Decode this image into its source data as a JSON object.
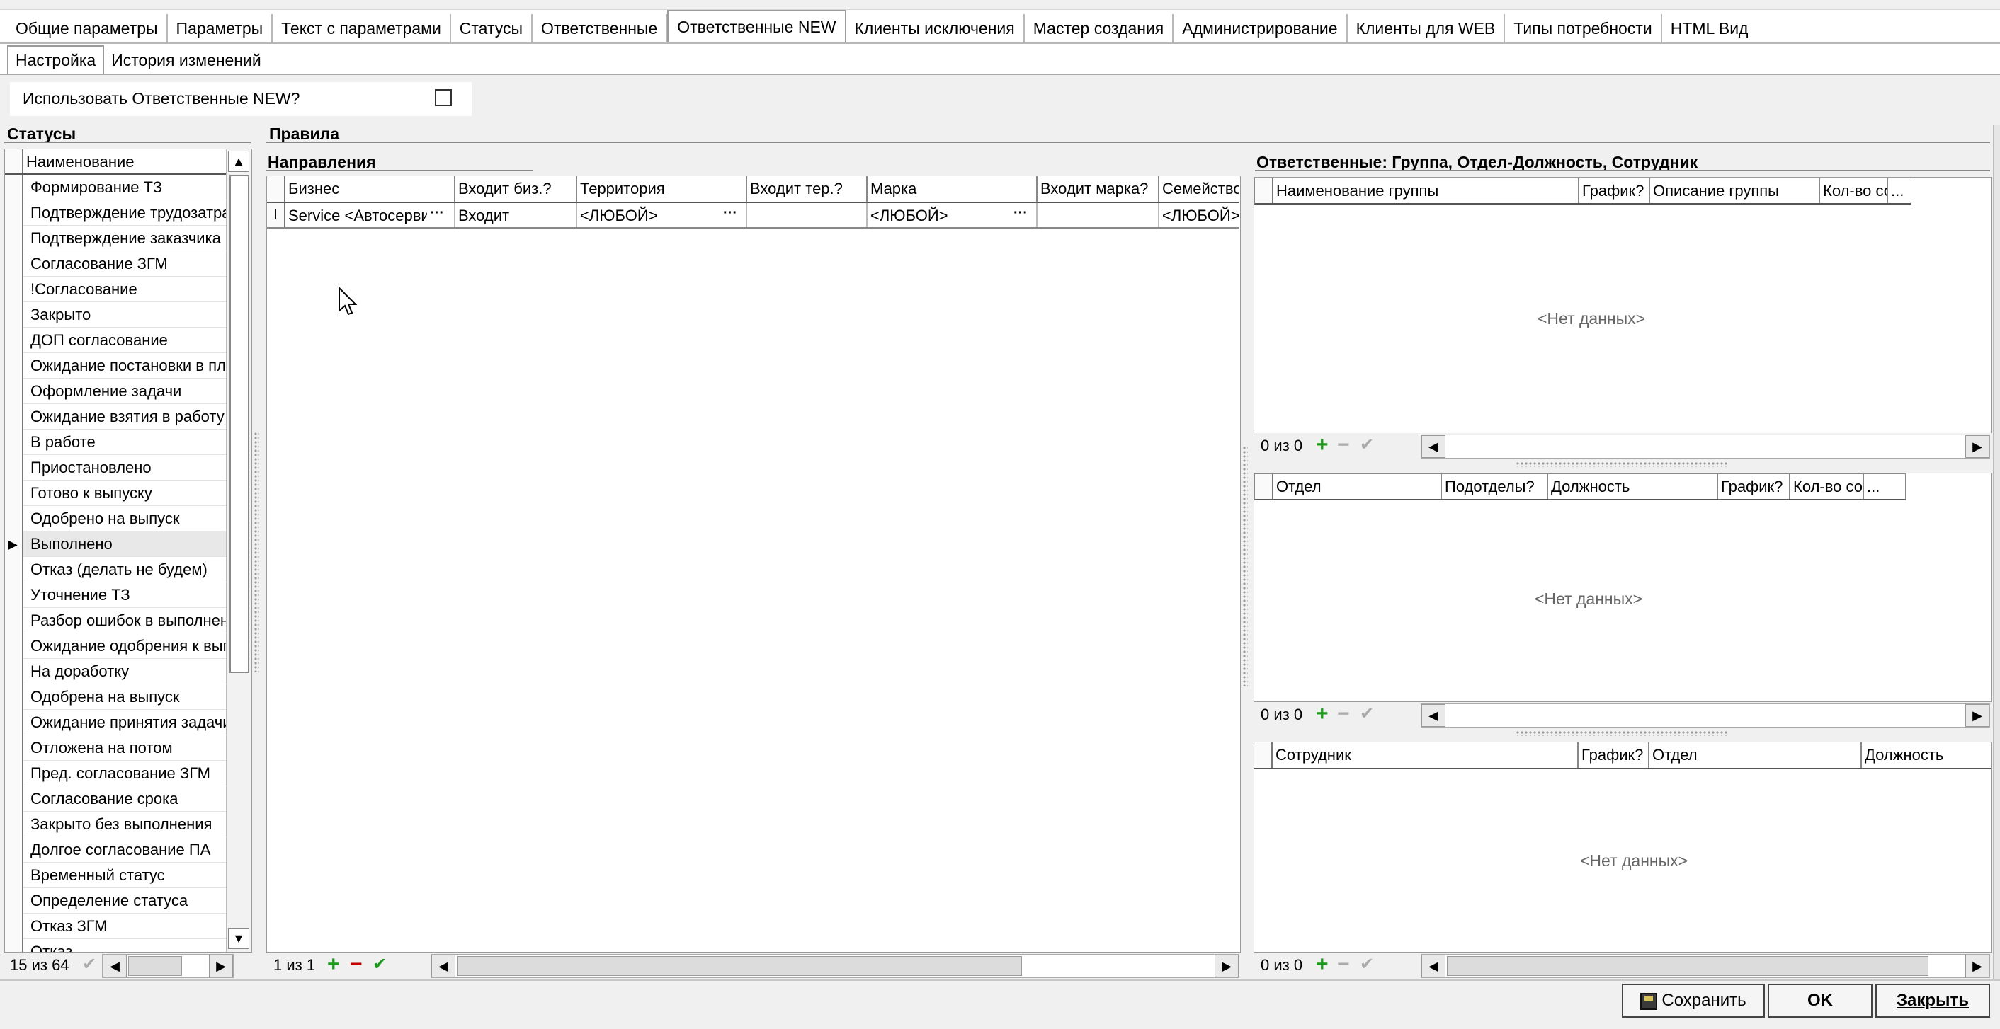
{
  "main_tabs": [
    "Общие параметры",
    "Параметры",
    "Текст с параметрами",
    "Статусы",
    "Ответственные",
    "Ответственные NEW",
    "Клиенты исключения",
    "Мастер создания",
    "Администрирование",
    "Клиенты для WEB",
    "Типы потребности",
    "HTML Вид"
  ],
  "active_main_tab": "Ответственные NEW",
  "sub_tabs": [
    "Настройка",
    "История изменений"
  ],
  "use_new": {
    "label": "Использовать Ответственные NEW?"
  },
  "statuses": {
    "title": "Статусы",
    "header": "Наименование",
    "items": [
      "Формирование ТЗ",
      "Подтверждение трудозатрат",
      "Подтверждение заказчика",
      "Согласование ЗГМ",
      "!Согласование",
      "Закрыто",
      "ДОП согласование",
      "Ожидание постановки в план",
      "Оформление задачи",
      "Ожидание взятия в работу",
      "В работе",
      "Приостановлено",
      "Готово к выпуску",
      "Одобрено на выпуск",
      "Выполнено",
      "Отказ (делать не будем)",
      "Уточнение ТЗ",
      "Разбор ошибок в выполнении",
      "Ожидание одобрения к выпуску",
      "На доработку",
      "Одобрена на выпуск",
      "Ожидание принятия задачи",
      "Отложена на потом",
      "Пред. согласование ЗГМ",
      "Согласование срока",
      "Закрыто без выполнения",
      "Долгое согласование ПА",
      "Временный статус",
      "Определение статуса",
      "Отказ ЗГМ",
      "Отказ"
    ],
    "selected": "Выполнено",
    "count": "15 из 64"
  },
  "rules": {
    "title": "Правила",
    "directions_title": "Направления",
    "columns": [
      "Бизнес",
      "Входит биз.?",
      "Территория",
      "Входит тер.?",
      "Марка",
      "Входит марка?",
      "Семейство"
    ],
    "row": {
      "business": "Service <Автосервис>",
      "business_in": "Входит",
      "territory": "<ЛЮБОЙ>",
      "territory_in": "",
      "brand": "<ЛЮБОЙ>",
      "brand_in": "",
      "family": "<ЛЮБОЙ>"
    },
    "count": "1 из 1"
  },
  "responsible": {
    "title": "Ответственные: Группа, Отдел-Должность, Сотрудник",
    "groups": {
      "columns": [
        "Наименование группы",
        "График?",
        "Описание группы",
        "Кол-во со",
        "..."
      ],
      "empty": "<Нет данных>",
      "count": "0 из 0"
    },
    "departments": {
      "columns": [
        "Отдел",
        "Подотделы?",
        "Должность",
        "График?",
        "Кол-во со",
        "..."
      ],
      "empty": "<Нет данных>",
      "count": "0 из 0"
    },
    "employees": {
      "columns": [
        "Сотрудник",
        "График?",
        "Отдел",
        "Должность"
      ],
      "empty": "<Нет данных>",
      "count": "0 из 0"
    }
  },
  "buttons": {
    "save": "Сохранить",
    "ok": "OK",
    "close": "Закрыть"
  },
  "ellipsis": "···"
}
